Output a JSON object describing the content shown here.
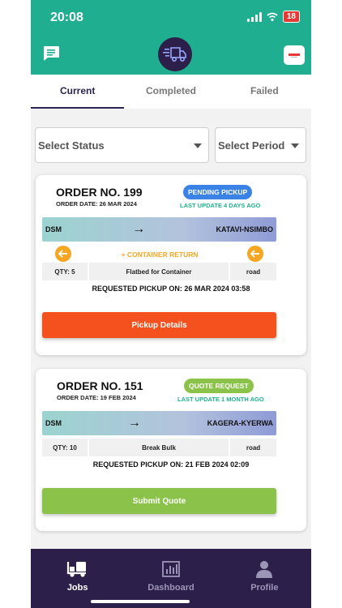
{
  "status_bar": {
    "time": "20:08",
    "battery": "18"
  },
  "tabs": [
    {
      "label": "Current",
      "active": true
    },
    {
      "label": "Completed",
      "active": false
    },
    {
      "label": "Failed",
      "active": false
    }
  ],
  "filters": {
    "status": {
      "value": "Select Status"
    },
    "period": {
      "value": "Select Period"
    }
  },
  "orders": [
    {
      "order_no": "ORDER NO. 199",
      "order_date": "ORDER DATE: 26 MAR 2024",
      "badge": "PENDING PICKUP",
      "badge_color": "#3b82e6",
      "last_update": "LAST UPDATE 4 DAYS AGO",
      "from": "DSM",
      "to": "KATAVI-NSIMBO",
      "container_return": "+ CONTAINER RETURN",
      "qty": "QTY: 5",
      "truck": "Flatbed for Container",
      "mode": "road",
      "requested": "REQUESTED PICKUP ON: 26 MAR 2024 03:58",
      "button": "Pickup Details",
      "button_color": "#f4511e"
    },
    {
      "order_no": "ORDER NO. 151",
      "order_date": "ORDER DATE: 19 FEB 2024",
      "badge": "QUOTE REQUEST",
      "badge_color": "#8bc34a",
      "last_update": "LAST UPDATE 1 MONTH AGO",
      "from": "DSM",
      "to": "KAGERA-KYERWA",
      "qty": "QTY: 10",
      "truck": "Break Bulk",
      "mode": "road",
      "requested": "REQUESTED PICKUP ON: 21 FEB 2024 02:09",
      "button": "Submit Quote",
      "button_color": "#8bc34a"
    }
  ],
  "bottom_nav": [
    {
      "label": "Jobs",
      "icon": "truck-icon",
      "active": true
    },
    {
      "label": "Dashboard",
      "icon": "chart-icon",
      "active": false
    },
    {
      "label": "Profile",
      "icon": "person-icon",
      "active": false
    }
  ],
  "colors": {
    "header": "#1fae8f",
    "nav": "#2c1f4a",
    "accent": "#f5a623"
  }
}
